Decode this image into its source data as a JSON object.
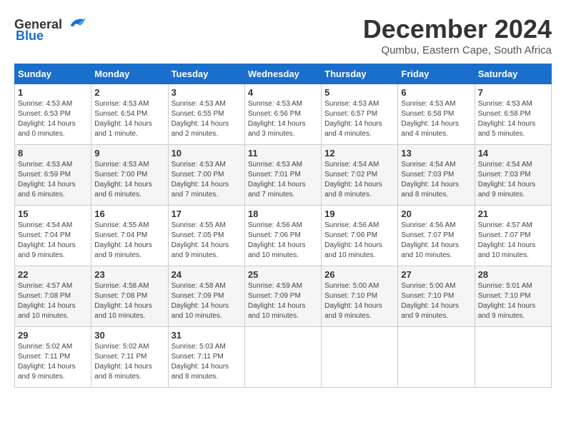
{
  "header": {
    "logo_general": "General",
    "logo_blue": "Blue",
    "month_title": "December 2024",
    "location": "Qumbu, Eastern Cape, South Africa"
  },
  "weekdays": [
    "Sunday",
    "Monday",
    "Tuesday",
    "Wednesday",
    "Thursday",
    "Friday",
    "Saturday"
  ],
  "weeks": [
    [
      {
        "day": "1",
        "sunrise": "4:53 AM",
        "sunset": "6:53 PM",
        "daylight": "14 hours and 0 minutes."
      },
      {
        "day": "2",
        "sunrise": "4:53 AM",
        "sunset": "6:54 PM",
        "daylight": "14 hours and 1 minute."
      },
      {
        "day": "3",
        "sunrise": "4:53 AM",
        "sunset": "6:55 PM",
        "daylight": "14 hours and 2 minutes."
      },
      {
        "day": "4",
        "sunrise": "4:53 AM",
        "sunset": "6:56 PM",
        "daylight": "14 hours and 3 minutes."
      },
      {
        "day": "5",
        "sunrise": "4:53 AM",
        "sunset": "6:57 PM",
        "daylight": "14 hours and 4 minutes."
      },
      {
        "day": "6",
        "sunrise": "4:53 AM",
        "sunset": "6:58 PM",
        "daylight": "14 hours and 4 minutes."
      },
      {
        "day": "7",
        "sunrise": "4:53 AM",
        "sunset": "6:58 PM",
        "daylight": "14 hours and 5 minutes."
      }
    ],
    [
      {
        "day": "8",
        "sunrise": "4:53 AM",
        "sunset": "6:59 PM",
        "daylight": "14 hours and 6 minutes."
      },
      {
        "day": "9",
        "sunrise": "4:53 AM",
        "sunset": "7:00 PM",
        "daylight": "14 hours and 6 minutes."
      },
      {
        "day": "10",
        "sunrise": "4:53 AM",
        "sunset": "7:00 PM",
        "daylight": "14 hours and 7 minutes."
      },
      {
        "day": "11",
        "sunrise": "4:53 AM",
        "sunset": "7:01 PM",
        "daylight": "14 hours and 7 minutes."
      },
      {
        "day": "12",
        "sunrise": "4:54 AM",
        "sunset": "7:02 PM",
        "daylight": "14 hours and 8 minutes."
      },
      {
        "day": "13",
        "sunrise": "4:54 AM",
        "sunset": "7:03 PM",
        "daylight": "14 hours and 8 minutes."
      },
      {
        "day": "14",
        "sunrise": "4:54 AM",
        "sunset": "7:03 PM",
        "daylight": "14 hours and 9 minutes."
      }
    ],
    [
      {
        "day": "15",
        "sunrise": "4:54 AM",
        "sunset": "7:04 PM",
        "daylight": "14 hours and 9 minutes."
      },
      {
        "day": "16",
        "sunrise": "4:55 AM",
        "sunset": "7:04 PM",
        "daylight": "14 hours and 9 minutes."
      },
      {
        "day": "17",
        "sunrise": "4:55 AM",
        "sunset": "7:05 PM",
        "daylight": "14 hours and 9 minutes."
      },
      {
        "day": "18",
        "sunrise": "4:56 AM",
        "sunset": "7:06 PM",
        "daylight": "14 hours and 10 minutes."
      },
      {
        "day": "19",
        "sunrise": "4:56 AM",
        "sunset": "7:06 PM",
        "daylight": "14 hours and 10 minutes."
      },
      {
        "day": "20",
        "sunrise": "4:56 AM",
        "sunset": "7:07 PM",
        "daylight": "14 hours and 10 minutes."
      },
      {
        "day": "21",
        "sunrise": "4:57 AM",
        "sunset": "7:07 PM",
        "daylight": "14 hours and 10 minutes."
      }
    ],
    [
      {
        "day": "22",
        "sunrise": "4:57 AM",
        "sunset": "7:08 PM",
        "daylight": "14 hours and 10 minutes."
      },
      {
        "day": "23",
        "sunrise": "4:58 AM",
        "sunset": "7:08 PM",
        "daylight": "14 hours and 10 minutes."
      },
      {
        "day": "24",
        "sunrise": "4:58 AM",
        "sunset": "7:09 PM",
        "daylight": "14 hours and 10 minutes."
      },
      {
        "day": "25",
        "sunrise": "4:59 AM",
        "sunset": "7:09 PM",
        "daylight": "14 hours and 10 minutes."
      },
      {
        "day": "26",
        "sunrise": "5:00 AM",
        "sunset": "7:10 PM",
        "daylight": "14 hours and 9 minutes."
      },
      {
        "day": "27",
        "sunrise": "5:00 AM",
        "sunset": "7:10 PM",
        "daylight": "14 hours and 9 minutes."
      },
      {
        "day": "28",
        "sunrise": "5:01 AM",
        "sunset": "7:10 PM",
        "daylight": "14 hours and 9 minutes."
      }
    ],
    [
      {
        "day": "29",
        "sunrise": "5:02 AM",
        "sunset": "7:11 PM",
        "daylight": "14 hours and 9 minutes."
      },
      {
        "day": "30",
        "sunrise": "5:02 AM",
        "sunset": "7:11 PM",
        "daylight": "14 hours and 8 minutes."
      },
      {
        "day": "31",
        "sunrise": "5:03 AM",
        "sunset": "7:11 PM",
        "daylight": "14 hours and 8 minutes."
      },
      null,
      null,
      null,
      null
    ]
  ],
  "labels": {
    "sunrise": "Sunrise:",
    "sunset": "Sunset:",
    "daylight": "Daylight:"
  }
}
